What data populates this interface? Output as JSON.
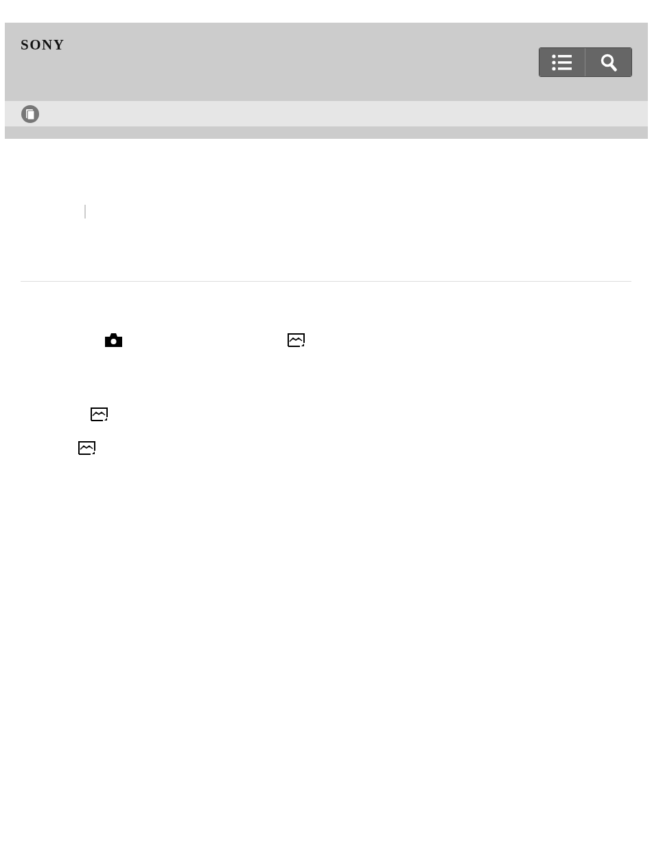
{
  "header": {
    "logo": "SONY"
  }
}
